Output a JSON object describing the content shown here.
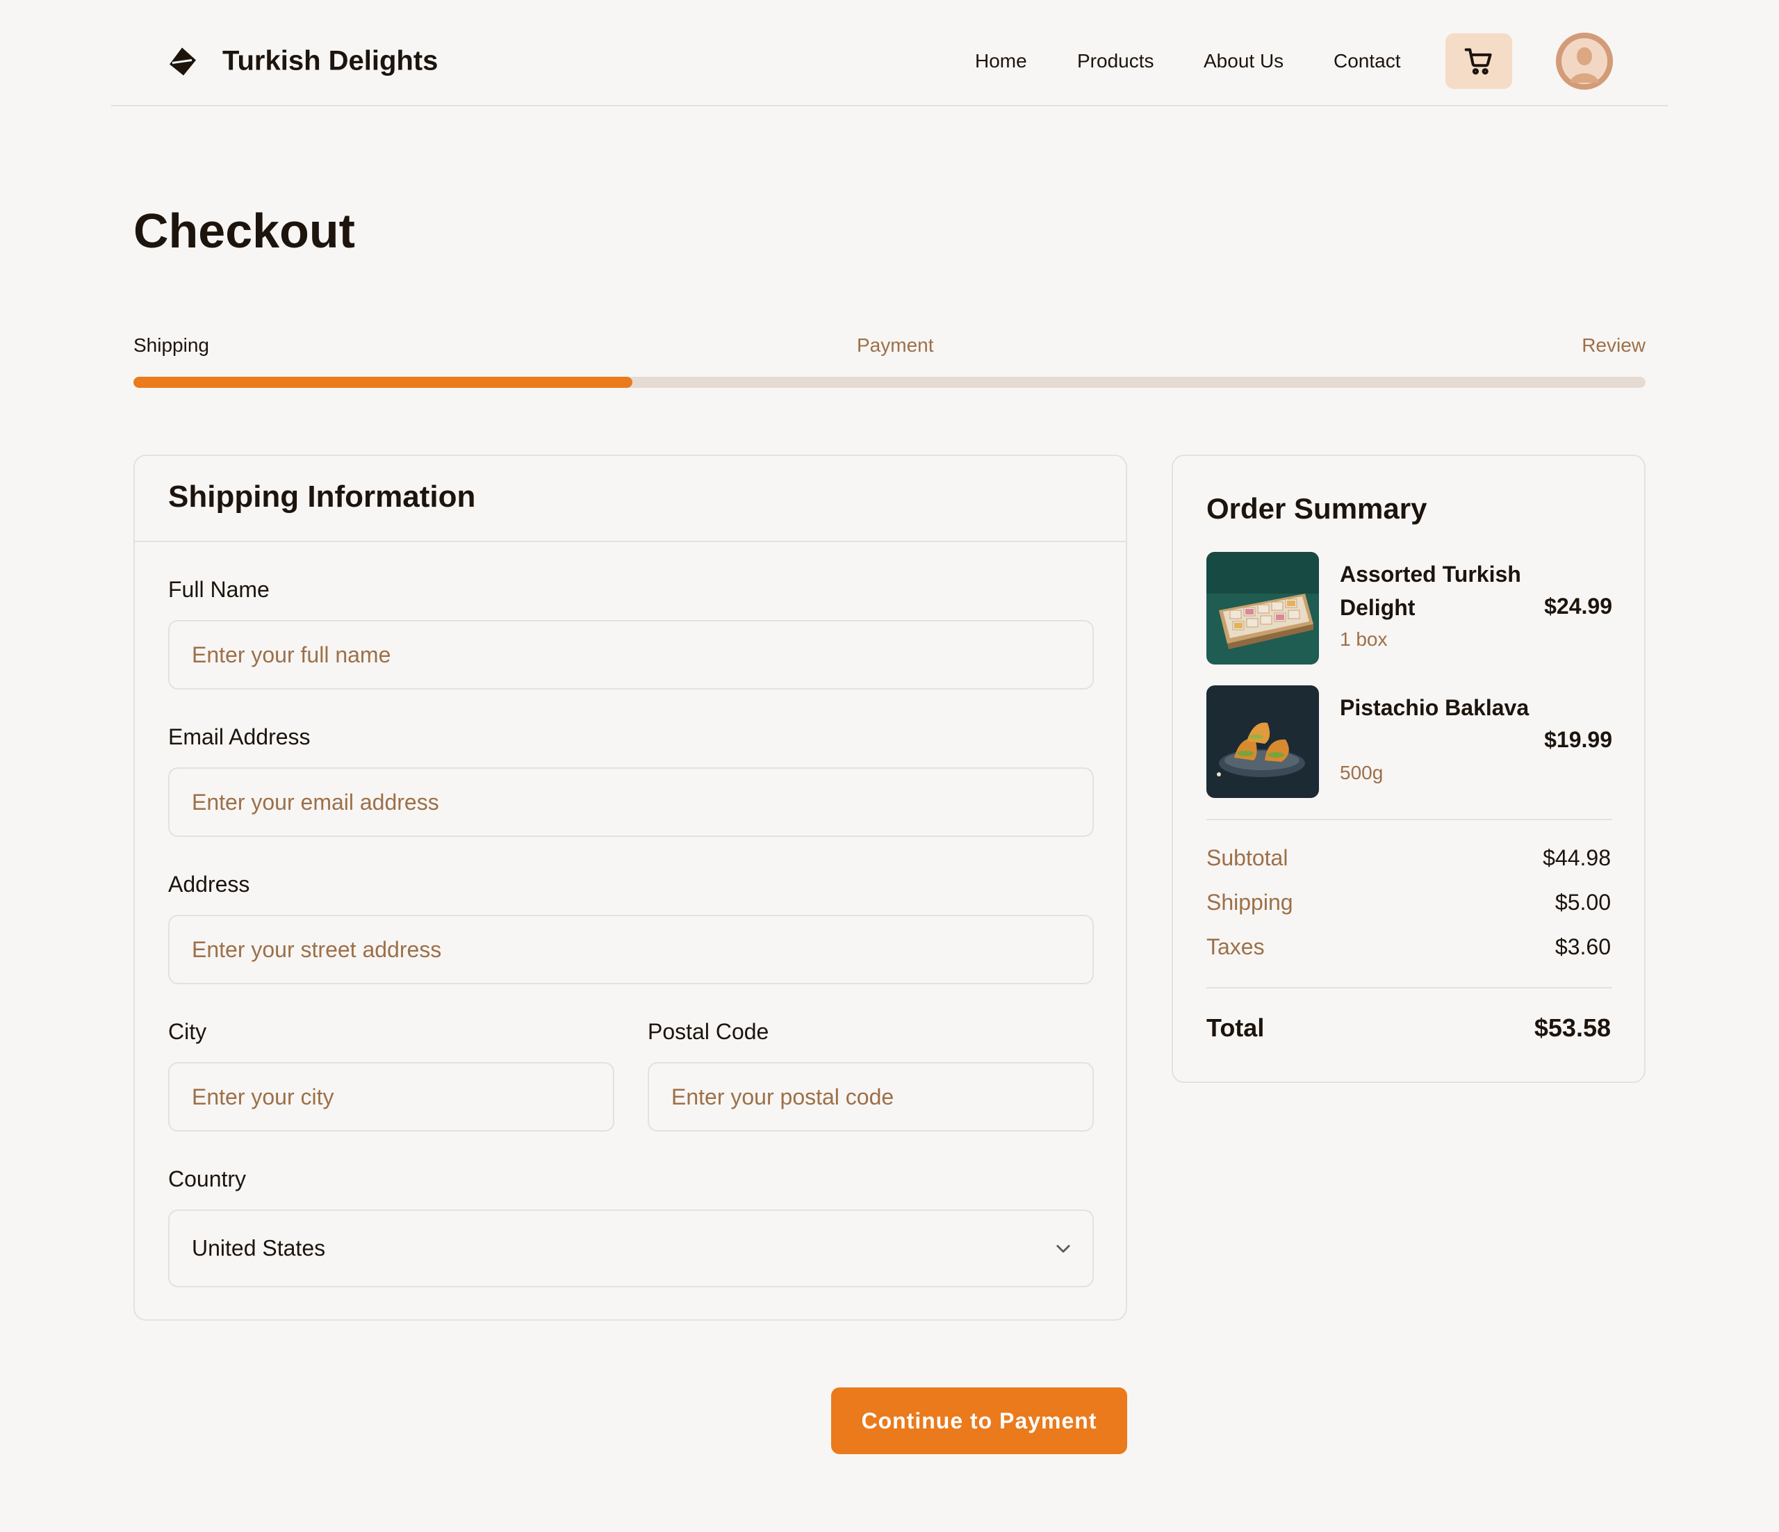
{
  "brand": {
    "name": "Turkish Delights",
    "logo_icon": "diamond-logo-icon"
  },
  "nav": {
    "items": [
      "Home",
      "Products",
      "About Us",
      "Contact"
    ]
  },
  "header": {
    "cart_icon": "cart-icon",
    "avatar_icon": "user-avatar"
  },
  "page": {
    "title": "Checkout"
  },
  "steps": {
    "items": [
      "Shipping",
      "Payment",
      "Review"
    ],
    "active": "Shipping",
    "progress_fraction": 0.33
  },
  "shipping_form": {
    "title": "Shipping Information",
    "full_name": {
      "label": "Full Name",
      "placeholder": "Enter your full name",
      "value": ""
    },
    "email": {
      "label": "Email Address",
      "placeholder": "Enter your email address",
      "value": ""
    },
    "address": {
      "label": "Address",
      "placeholder": "Enter your street address",
      "value": ""
    },
    "city": {
      "label": "City",
      "placeholder": "Enter your city",
      "value": ""
    },
    "postal": {
      "label": "Postal Code",
      "placeholder": "Enter your postal code",
      "value": ""
    },
    "country": {
      "label": "Country",
      "value": "United States"
    }
  },
  "order_summary": {
    "title": "Order Summary",
    "items": [
      {
        "name": "Assorted Turkish Delight",
        "qty": "1 box",
        "price": "$24.99"
      },
      {
        "name": "Pistachio Baklava",
        "qty": "500g",
        "price": "$19.99"
      }
    ],
    "subtotal": {
      "label": "Subtotal",
      "value": "$44.98"
    },
    "shipping": {
      "label": "Shipping",
      "value": "$5.00"
    },
    "taxes": {
      "label": "Taxes",
      "value": "$3.60"
    },
    "total": {
      "label": "Total",
      "value": "$53.58"
    }
  },
  "cta": {
    "label": "Continue to Payment"
  },
  "colors": {
    "accent": "#ea7a1c",
    "muted_text": "#9c7049",
    "cart_bg": "#f5dcc7",
    "border": "#e6e0dc",
    "background": "#f8f6f4"
  }
}
